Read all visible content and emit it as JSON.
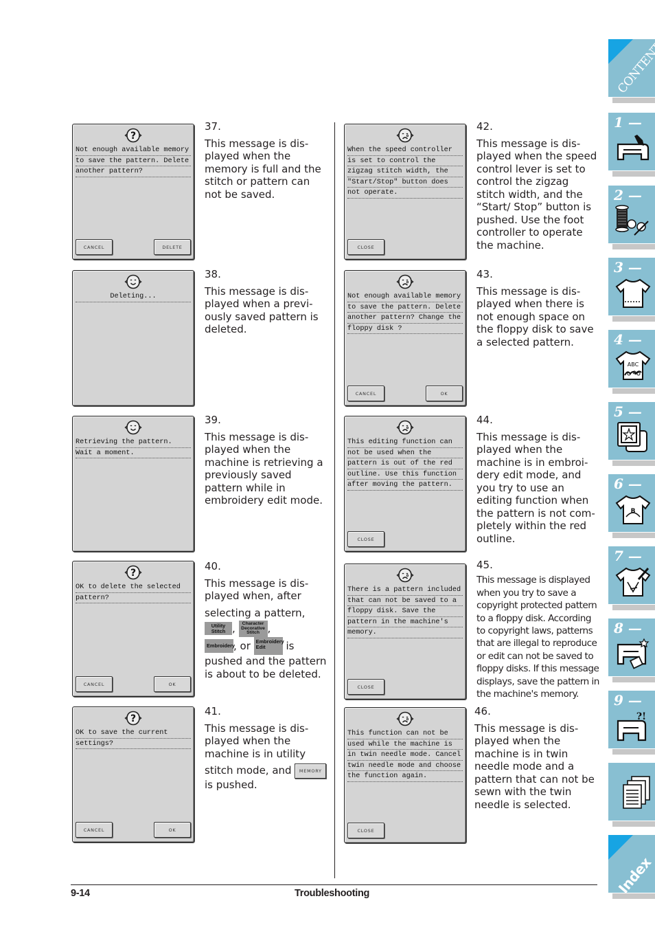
{
  "page": {
    "number": "9-14",
    "section_title": "Troubleshooting"
  },
  "sidebar": {
    "contents_label": "CONTENTS",
    "index_label": "Index",
    "tabs": [
      {
        "label": "1 —",
        "icon": "sewing-machine-threading-icon"
      },
      {
        "label": "2 —",
        "icon": "thread-spool-scissors-icon"
      },
      {
        "label": "3 —",
        "icon": "tshirt-stitch-icon"
      },
      {
        "label": "4 —",
        "icon": "tshirt-abc-embroidery-icon"
      },
      {
        "label": "5 —",
        "icon": "embroidery-frame-icon"
      },
      {
        "label": "6 —",
        "icon": "tshirt-edit-icon"
      },
      {
        "label": "7 —",
        "icon": "tshirt-pen-icon"
      },
      {
        "label": "8 —",
        "icon": "sewing-machine-maintenance-icon"
      },
      {
        "label": "9 —",
        "icon": "sewing-machine-question-icon"
      }
    ],
    "appendix_icon": "document-pages-icon"
  },
  "messages": [
    {
      "number": "37.",
      "icon": "question-face-icon",
      "screen_lines": [
        "Not enough available memory",
        "to save the pattern. Delete",
        "another pattern?"
      ],
      "buttons": [
        "CANCEL",
        "DELETE"
      ],
      "description": "This message is dis-played when the memory is full and the stitch or pattern can not be saved."
    },
    {
      "number": "38.",
      "icon": "smile-face-icon",
      "screen_lines": [
        "Deleting..."
      ],
      "buttons": [],
      "description": "This message is dis-played when a previ-ously saved pattern is deleted."
    },
    {
      "number": "39.",
      "icon": "smile-face-icon",
      "screen_lines": [
        "Retrieving the pattern.",
        "Wait a moment."
      ],
      "buttons": [],
      "description": "This message is dis-played when the machine is retrieving a previously saved pattern while in embroidery edit mode."
    },
    {
      "number": "40.",
      "icon": "question-face-icon",
      "screen_lines": [
        "OK to delete the selected",
        "pattern?"
      ],
      "buttons": [
        "CANCEL",
        "OK"
      ],
      "description_parts": {
        "intro": "This message is dis-played when, after",
        "selecting": "selecting a pattern,",
        "key_utility": "Utility Stitch",
        "key_character": "Character Decorative Stitch",
        "key_embroidery": "Embroidery",
        "or": ", or",
        "key_embroidery_edit": "Embroidery Edit",
        "is": "is",
        "outro": "pushed and the pattern is about to be deleted."
      }
    },
    {
      "number": "41.",
      "icon": "question-face-icon",
      "screen_lines": [
        "OK to save the current",
        "settings?"
      ],
      "buttons": [
        "CANCEL",
        "OK"
      ],
      "description_parts": {
        "intro": "This message is dis-played when the machine is in utility",
        "stitch": "stitch mode, and",
        "key_memory": "MEMORY",
        "outro": "is pushed."
      }
    },
    {
      "number": "42.",
      "icon": "sad-face-icon",
      "screen_lines": [
        "When the speed controller",
        "is set to control the",
        "zigzag stitch width, the",
        "\"Start/Stop\" button does",
        "not operate."
      ],
      "buttons": [
        "CLOSE"
      ],
      "description": "This message is dis-played when the speed control lever is set to control the zigzag stitch width, and the “Start/ Stop” button is pushed. Use the foot controller to operate the machine."
    },
    {
      "number": "43.",
      "icon": "sad-face-icon",
      "screen_lines": [
        "Not enough available memory",
        "to save the pattern. Delete",
        "another pattern? Change the",
        "floppy disk ?"
      ],
      "buttons": [
        "CANCEL",
        "OK"
      ],
      "description": "This message is dis-played when there is not enough space on the floppy disk to save a selected pattern."
    },
    {
      "number": "44.",
      "icon": "sad-face-icon",
      "screen_lines": [
        "This editing function can",
        "not be used when the",
        "pattern is out of the red",
        "outline. Use this function",
        "after moving the pattern."
      ],
      "buttons": [
        "CLOSE"
      ],
      "description": "This message is dis-played when the machine is in embroi-dery edit mode, and you try to use an editing function when the pattern is not com-pletely within the red outline."
    },
    {
      "number": "45.",
      "icon": "sad-face-icon",
      "screen_lines": [
        "There is a pattern included",
        "that can not be saved to a",
        "floppy disk. Save the",
        "pattern in the machine's",
        "memory."
      ],
      "buttons": [
        "CLOSE"
      ],
      "description": "This message is displayed when you try to save a copyright protected pattern to a floppy disk. According to copyright laws, patterns that are illegal to reproduce or edit can not be saved to floppy disks. If this message displays, save the pattern in the machine's memory."
    },
    {
      "number": "46.",
      "icon": "sad-face-icon",
      "screen_lines": [
        "This function can not be",
        "used while the machine is",
        "in twin needle mode. Cancel",
        "twin needle mode and choose",
        "the function again."
      ],
      "buttons": [
        "CLOSE"
      ],
      "description": "This message is dis-played when the machine is in twin needle mode and a pattern that can not be sewn with the twin needle is selected."
    }
  ]
}
